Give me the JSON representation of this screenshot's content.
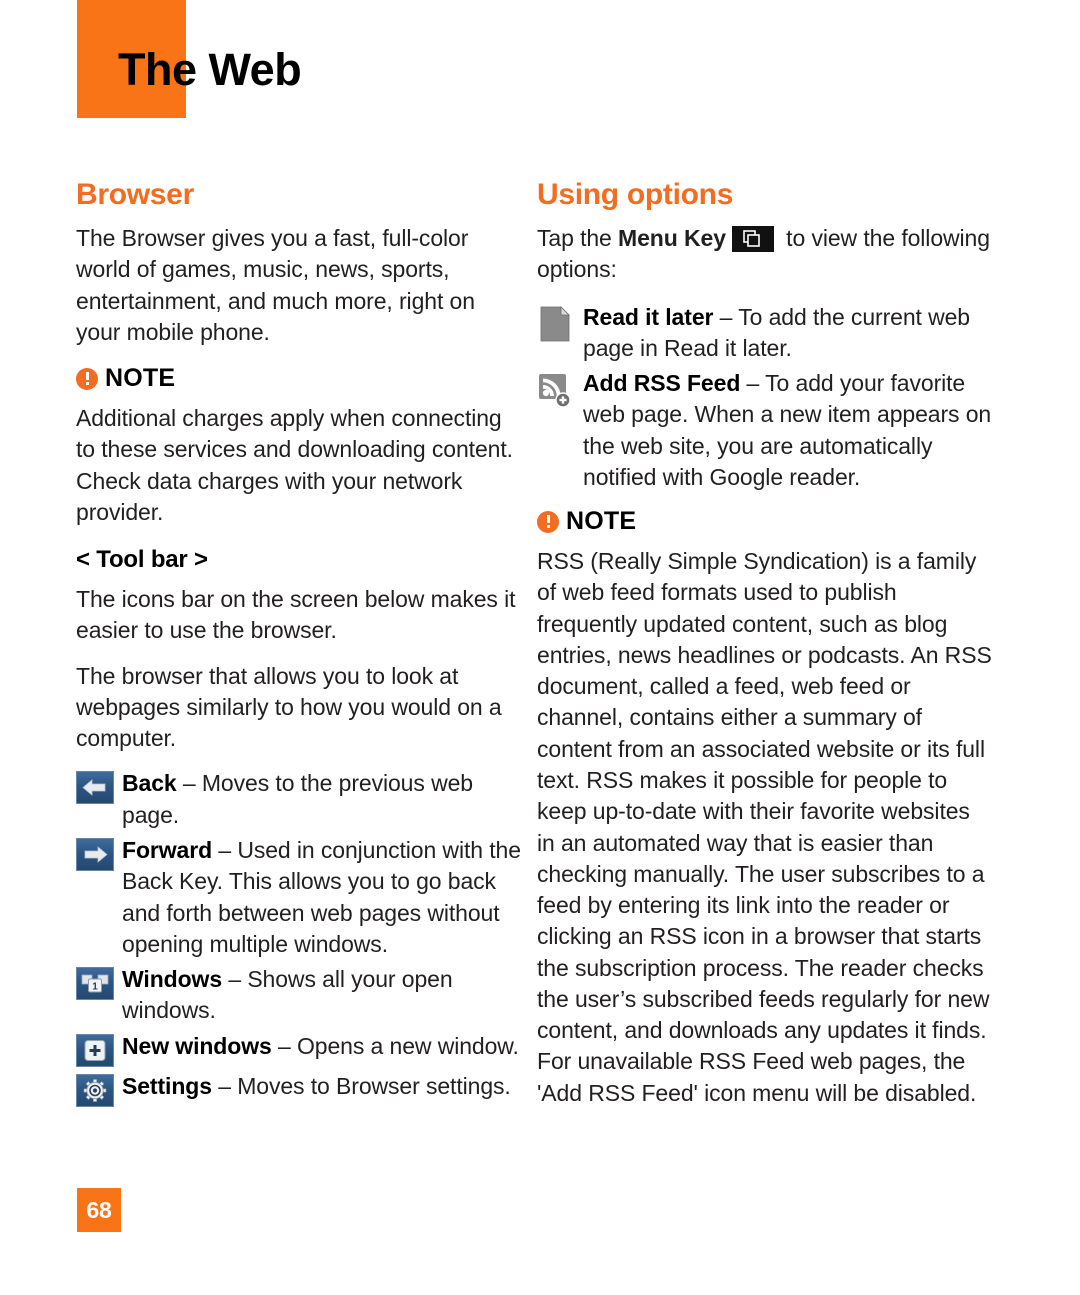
{
  "header": {
    "title": "The Web",
    "block_color": "#f97317"
  },
  "left_column": {
    "section_title": "Browser",
    "intro": "The Browser gives you a fast, full-color world of games, music, news, sports, entertainment, and much more, right on your mobile phone.",
    "note": {
      "label": "NOTE",
      "icon": "exclamation-circle-icon",
      "text": "Additional charges apply when connecting to these services and downloading content. Check data charges with your network provider."
    },
    "sub_head": "< Tool bar >",
    "paragraphs": [
      "The icons bar on the screen below makes it easier to use the browser.",
      "The browser that allows you to look at webpages similarly to how you would on a computer."
    ],
    "toolbar_items": [
      {
        "icon": "back-arrow-icon",
        "name": "Back",
        "dash": " – ",
        "description": "Moves to the previous web page."
      },
      {
        "icon": "forward-arrow-icon",
        "name": "Forward",
        "dash": " – ",
        "description": "Used in conjunction with the Back Key. This allows you to go back and forth between web pages without opening multiple windows."
      },
      {
        "icon": "windows-stack-icon",
        "name": "Windows",
        "dash": " – ",
        "description": "Shows all your open windows."
      },
      {
        "icon": "new-window-plus-icon",
        "name": "New windows",
        "dash": " – ",
        "description": "Opens a new window."
      },
      {
        "icon": "gear-icon",
        "name": "Settings",
        "dash": " – ",
        "description": "Moves to Browser settings."
      }
    ]
  },
  "right_column": {
    "section_title": "Using options",
    "intro_prefix": "Tap the ",
    "intro_bold": "Menu Key",
    "menu_key_icon": "menu-key-icon",
    "intro_suffix": " to view the following options:",
    "option_items": [
      {
        "icon": "document-page-icon",
        "name": "Read it later",
        "dash": " – ",
        "description": "To add the current web page in Read it later."
      },
      {
        "icon": "rss-add-icon",
        "name": "Add RSS Feed",
        "dash": " – ",
        "description": "To add your favorite web page. When a new item appears on the web site, you are automatically notified with Google reader."
      }
    ],
    "note": {
      "label": "NOTE",
      "icon": "exclamation-circle-icon",
      "text": "RSS (Really Simple Syndication) is a family of web feed formats used to publish frequently updated content, such as blog entries, news headlines or podcasts. An RSS document, called a feed, web feed or channel, contains either a summary of content from an associated website or its full text. RSS makes it possible for people to keep up-to-date with their favorite websites in an automated way that is easier than checking manually. The user subscribes to a feed by entering its link into the reader or clicking an RSS icon in a browser that starts the subscription process. The reader checks the user’s subscribed feeds regularly for new content, and downloads any updates it finds. For unavailable RSS Feed web pages, the 'Add RSS Feed' icon menu will be disabled."
    }
  },
  "footer": {
    "page_number": "68"
  },
  "colors": {
    "accent_orange": "#f26c21",
    "header_orange": "#f97317",
    "body_text": "#231f20",
    "button_blue": "#2c5584"
  }
}
